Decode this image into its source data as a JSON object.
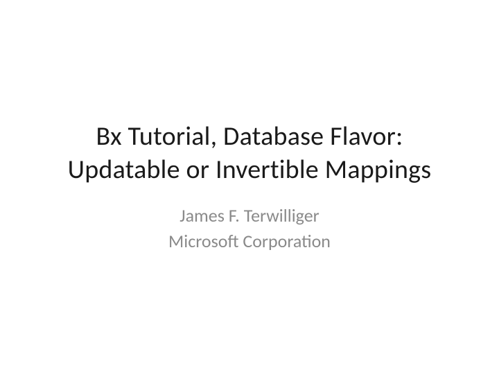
{
  "slide": {
    "title_line1": "Bx Tutorial, Database Flavor:",
    "title_line2": "Updatable or Invertible Mappings",
    "author": "James F. Terwilliger",
    "affiliation": "Microsoft Corporation"
  }
}
